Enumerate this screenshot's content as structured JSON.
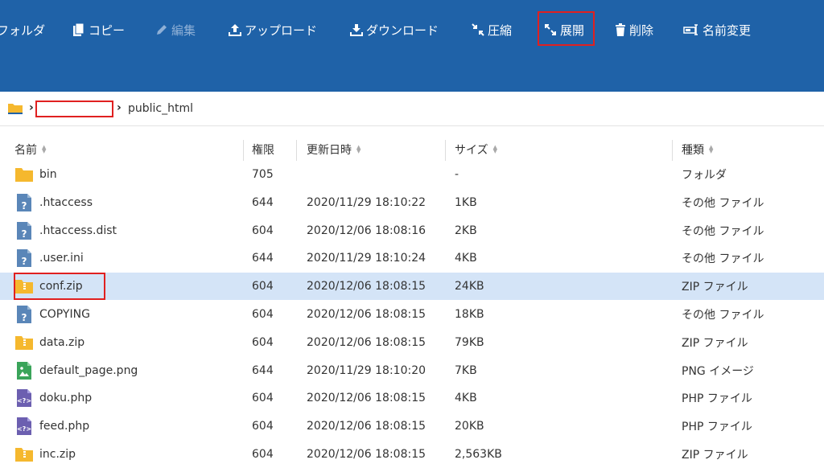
{
  "toolbar": {
    "items": [
      {
        "label": "フォルダ",
        "icon": "folder-icon",
        "disabled": false
      },
      {
        "label": "コピー",
        "icon": "copy-icon",
        "disabled": false
      },
      {
        "label": "編集",
        "icon": "pencil-icon",
        "disabled": true
      },
      {
        "label": "アップロード",
        "icon": "upload-icon",
        "disabled": false
      },
      {
        "label": "ダウンロード",
        "icon": "download-icon",
        "disabled": false
      },
      {
        "label": "圧縮",
        "icon": "compress-icon",
        "disabled": false
      },
      {
        "label": "展開",
        "icon": "expand-icon",
        "disabled": false
      },
      {
        "label": "削除",
        "icon": "trash-icon",
        "disabled": false
      },
      {
        "label": "名前変更",
        "icon": "rename-icon",
        "disabled": false
      }
    ]
  },
  "breadcrumb": {
    "current": "public_html"
  },
  "columns": {
    "name": "名前",
    "permission": "権限",
    "modified": "更新日時",
    "size": "サイズ",
    "type": "種類"
  },
  "files": [
    {
      "name": "bin",
      "permission": "705",
      "modified": "",
      "size": "-",
      "type": "フォルダ",
      "icon": "folder-icon"
    },
    {
      "name": ".htaccess",
      "permission": "644",
      "modified": "2020/11/29 18:10:22",
      "size": "1KB",
      "type": "その他 ファイル",
      "icon": "unknown-file-icon"
    },
    {
      "name": ".htaccess.dist",
      "permission": "604",
      "modified": "2020/12/06 18:08:16",
      "size": "2KB",
      "type": "その他 ファイル",
      "icon": "unknown-file-icon"
    },
    {
      "name": ".user.ini",
      "permission": "644",
      "modified": "2020/11/29 18:10:24",
      "size": "4KB",
      "type": "その他 ファイル",
      "icon": "unknown-file-icon"
    },
    {
      "name": "conf.zip",
      "permission": "604",
      "modified": "2020/12/06 18:08:15",
      "size": "24KB",
      "type": "ZIP ファイル",
      "icon": "zip-icon",
      "selected": true
    },
    {
      "name": "COPYING",
      "permission": "604",
      "modified": "2020/12/06 18:08:15",
      "size": "18KB",
      "type": "その他 ファイル",
      "icon": "unknown-file-icon"
    },
    {
      "name": "data.zip",
      "permission": "604",
      "modified": "2020/12/06 18:08:15",
      "size": "79KB",
      "type": "ZIP ファイル",
      "icon": "zip-icon"
    },
    {
      "name": "default_page.png",
      "permission": "644",
      "modified": "2020/11/29 18:10:20",
      "size": "7KB",
      "type": "PNG イメージ",
      "icon": "image-file-icon"
    },
    {
      "name": "doku.php",
      "permission": "604",
      "modified": "2020/12/06 18:08:15",
      "size": "4KB",
      "type": "PHP ファイル",
      "icon": "php-file-icon"
    },
    {
      "name": "feed.php",
      "permission": "604",
      "modified": "2020/12/06 18:08:15",
      "size": "20KB",
      "type": "PHP ファイル",
      "icon": "php-file-icon"
    },
    {
      "name": "inc.zip",
      "permission": "604",
      "modified": "2020/12/06 18:08:15",
      "size": "2,563KB",
      "type": "ZIP ファイル",
      "icon": "zip-icon"
    }
  ],
  "colors": {
    "toolbar_bg": "#1f62a8",
    "selected_row": "#d4e4f7",
    "highlight": "#e02020",
    "folder": "#f5b82e"
  }
}
